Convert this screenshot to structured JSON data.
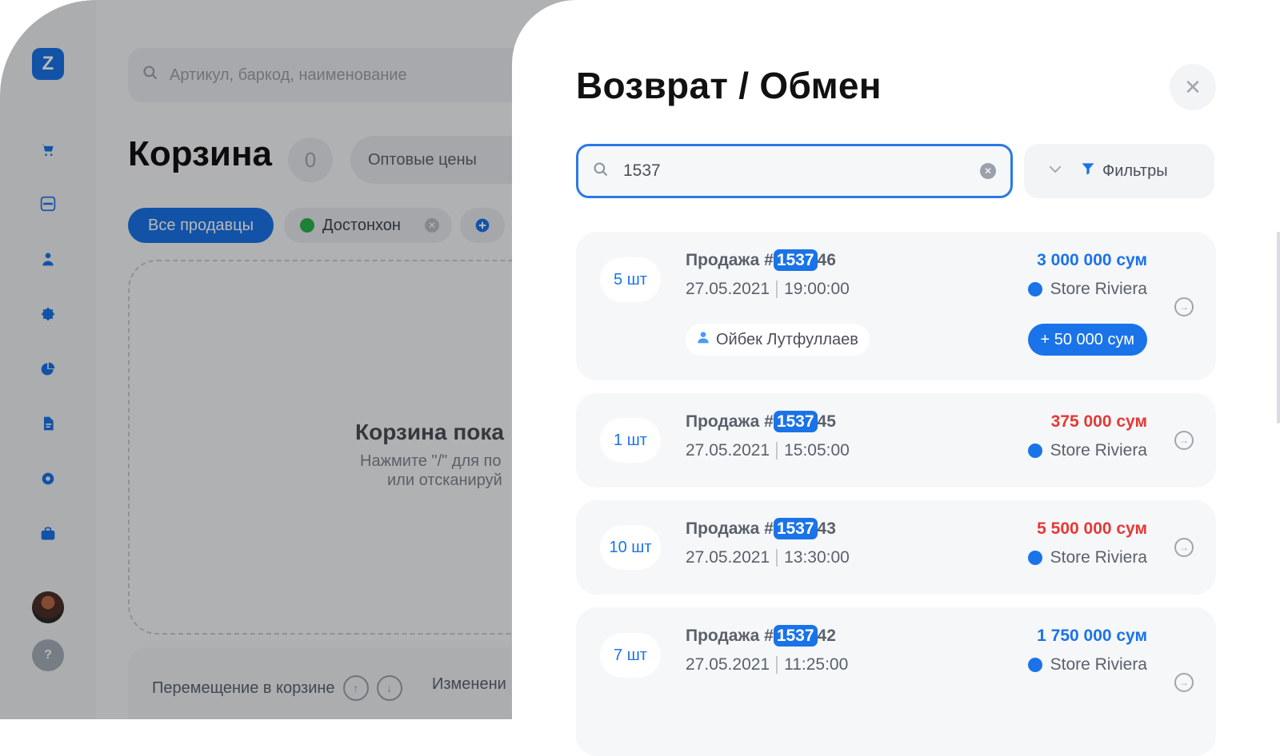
{
  "app": {
    "logo": "Z",
    "search_placeholder": "Артикул, баркод, наименование",
    "cart_title": "Корзина",
    "cart_count": "0",
    "wholesale_label": "Оптовые цены",
    "sellers_all": "Все продавцы",
    "seller_chip": "Достонхон",
    "empty_title": "Корзина пока",
    "empty_line1": "Нажмите \"/\" для по",
    "empty_line2": "или отсканируй",
    "move_label": "Перемещение в корзине",
    "change_label": "Изменени"
  },
  "sidebar": {
    "icons": [
      "cart-icon",
      "scanner-icon",
      "user-icon",
      "badge-icon",
      "pie-chart-icon",
      "document-icon",
      "gear-icon",
      "briefcase-icon"
    ],
    "help_label": "?"
  },
  "panel": {
    "title": "Возврат / Обмен",
    "search_value": "1537",
    "filters_label": "Фильтры",
    "sales": [
      {
        "qty": "5 шт",
        "prefix": "Продажа #",
        "hl": "1537",
        "suffix": "46",
        "date": "27.05.2021",
        "time": "19:00:00",
        "amount": "3 000 000 сум",
        "amount_color": "#1a73e8",
        "store": "Store Riviera",
        "client": "Ойбек Лутфуллаев",
        "delta": "+ 50 000 сум"
      },
      {
        "qty": "1 шт",
        "prefix": "Продажа #",
        "hl": "1537",
        "suffix": "45",
        "date": "27.05.2021",
        "time": "15:05:00",
        "amount": "375 000 сум",
        "amount_color": "#e53935",
        "store": "Store Riviera"
      },
      {
        "qty": "10 шт",
        "prefix": "Продажа #",
        "hl": "1537",
        "suffix": "43",
        "date": "27.05.2021",
        "time": "13:30:00",
        "amount": "5 500 000 сум",
        "amount_color": "#e53935",
        "store": "Store Riviera"
      },
      {
        "qty": "7 шт",
        "prefix": "Продажа #",
        "hl": "1537",
        "suffix": "42",
        "date": "27.05.2021",
        "time": "11:25:00",
        "amount": "1 750 000 сум",
        "amount_color": "#1a73e8",
        "store": "Store Riviera"
      }
    ]
  }
}
